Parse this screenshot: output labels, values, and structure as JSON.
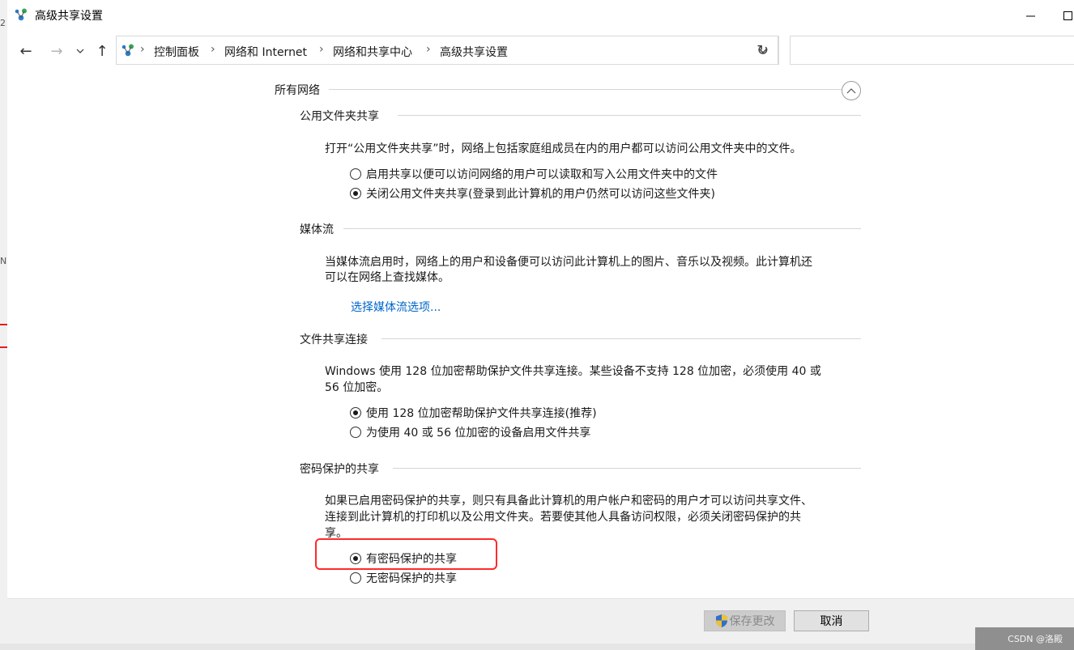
{
  "window": {
    "title": "高级共享设置"
  },
  "breadcrumb": [
    "控制面板",
    "网络和 Internet",
    "网络和共享中心",
    "高级共享设置"
  ],
  "section": {
    "title": "所有网络"
  },
  "public_folder": {
    "heading": "公用文件夹共享",
    "desc": "打开“公用文件夹共享”时，网络上包括家庭组成员在内的用户都可以访问公用文件夹中的文件。",
    "options": [
      {
        "label": "启用共享以便可以访问网络的用户可以读取和写入公用文件夹中的文件",
        "selected": false
      },
      {
        "label": "关闭公用文件夹共享(登录到此计算机的用户仍然可以访问这些文件夹)",
        "selected": true
      }
    ]
  },
  "media": {
    "heading": "媒体流",
    "desc_line1": "当媒体流启用时，网络上的用户和设备便可以访问此计算机上的图片、音乐以及视频。此计算机还",
    "desc_line2": "可以在网络上查找媒体。",
    "link": "选择媒体流选项..."
  },
  "file_sharing": {
    "heading": "文件共享连接",
    "desc_line1": "Windows 使用 128 位加密帮助保护文件共享连接。某些设备不支持 128 位加密，必须使用 40 或",
    "desc_line2": "56 位加密。",
    "options": [
      {
        "label": "使用 128 位加密帮助保护文件共享连接(推荐)",
        "selected": true
      },
      {
        "label": "为使用 40 或 56 位加密的设备启用文件共享",
        "selected": false
      }
    ]
  },
  "password": {
    "heading": "密码保护的共享",
    "desc_line1": "如果已启用密码保护的共享，则只有具备此计算机的用户帐户和密码的用户才可以访问共享文件、",
    "desc_line2": "连接到此计算机的打印机以及公用文件夹。若要使其他人具备访问权限，必须关闭密码保护的共",
    "desc_line3": "享。",
    "options": [
      {
        "label": "有密码保护的共享",
        "selected": true
      },
      {
        "label": "无密码保护的共享",
        "selected": false
      }
    ]
  },
  "footer": {
    "save_label": "保存更改",
    "cancel_label": "取消"
  },
  "watermark": "CSDN @洛殿",
  "accent_colors": {
    "link": "#0066cc",
    "highlight": "#ff2a2a"
  }
}
